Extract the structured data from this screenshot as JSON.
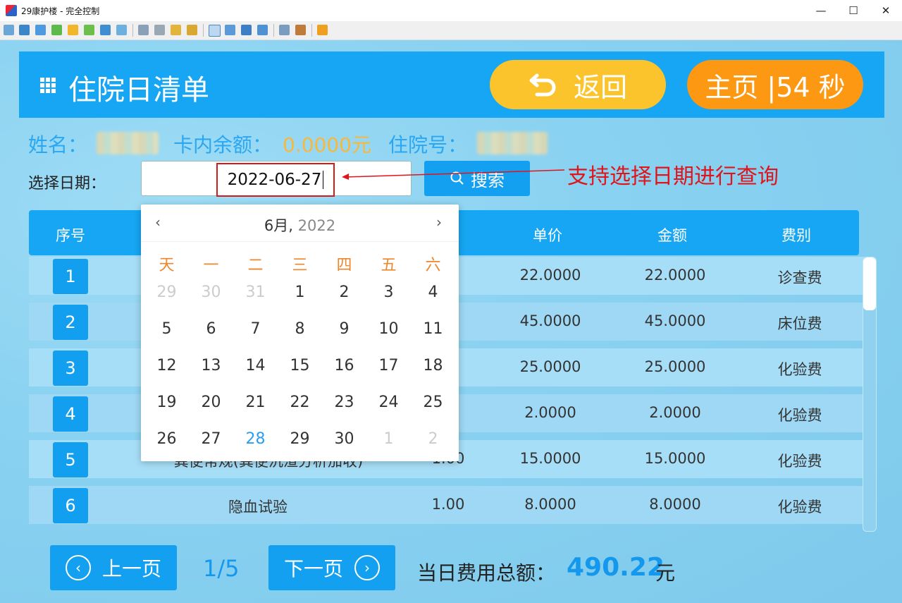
{
  "window": {
    "title": "29康护楼 - 完全控制",
    "minimize": "—",
    "maximize": "☐",
    "close": "✕"
  },
  "header": {
    "title": "住院日清单",
    "back_label": "返回",
    "home_label": "主页 |54 秒"
  },
  "patient": {
    "name_label": "姓名：",
    "balance_label": "卡内余额：",
    "balance_value": "0.0000元",
    "admission_label": "住院号："
  },
  "date_filter": {
    "label": "选择日期：",
    "value": "2022-06-27",
    "search_label": "搜索"
  },
  "annotation": "支持选择日期进行查询",
  "table": {
    "headers": {
      "seq": "序号",
      "price": "单价",
      "amount": "金额",
      "category": "费别"
    },
    "rows": [
      {
        "seq": "1",
        "qty": "",
        "price": "22.0000",
        "amount": "22.0000",
        "category": "诊查费",
        "name": ""
      },
      {
        "seq": "2",
        "qty": "",
        "price": "45.0000",
        "amount": "45.0000",
        "category": "床位费",
        "name": ""
      },
      {
        "seq": "3",
        "qty": "",
        "price": "25.0000",
        "amount": "25.0000",
        "category": "化验费",
        "name": ""
      },
      {
        "seq": "4",
        "qty": "",
        "price": "2.0000",
        "amount": "2.0000",
        "category": "化验费",
        "name": ""
      },
      {
        "seq": "5",
        "qty": "1.00",
        "price": "15.0000",
        "amount": "15.0000",
        "category": "化验费",
        "name": "粪便常规(粪便沉渣分析加收)"
      },
      {
        "seq": "6",
        "qty": "1.00",
        "price": "8.0000",
        "amount": "8.0000",
        "category": "化验费",
        "name": "隐血试验"
      }
    ]
  },
  "calendar": {
    "month": "6月,",
    "year": "2022",
    "prev": "‹",
    "next": "›",
    "weekdays": [
      "天",
      "一",
      "二",
      "三",
      "四",
      "五",
      "六"
    ],
    "weeks": [
      [
        "29",
        "30",
        "31",
        "1",
        "2",
        "3",
        "4"
      ],
      [
        "5",
        "6",
        "7",
        "8",
        "9",
        "10",
        "11"
      ],
      [
        "12",
        "13",
        "14",
        "15",
        "16",
        "17",
        "18"
      ],
      [
        "19",
        "20",
        "21",
        "22",
        "23",
        "24",
        "25"
      ],
      [
        "26",
        "27",
        "28",
        "29",
        "30",
        "1",
        "2"
      ]
    ]
  },
  "pager": {
    "prev_label": "上一页",
    "next_label": "下一页",
    "page": "1/5",
    "prev_icon": "‹",
    "next_icon": "›"
  },
  "total": {
    "label": "当日费用总额：",
    "value": "490.22",
    "unit": "元"
  },
  "colors": {
    "header_blue": "#16a6f3",
    "back_yellow": "#fbc32c",
    "home_orange": "#fc9812",
    "annotation_red": "#e0141a",
    "weekday_orange": "#f0862a"
  }
}
